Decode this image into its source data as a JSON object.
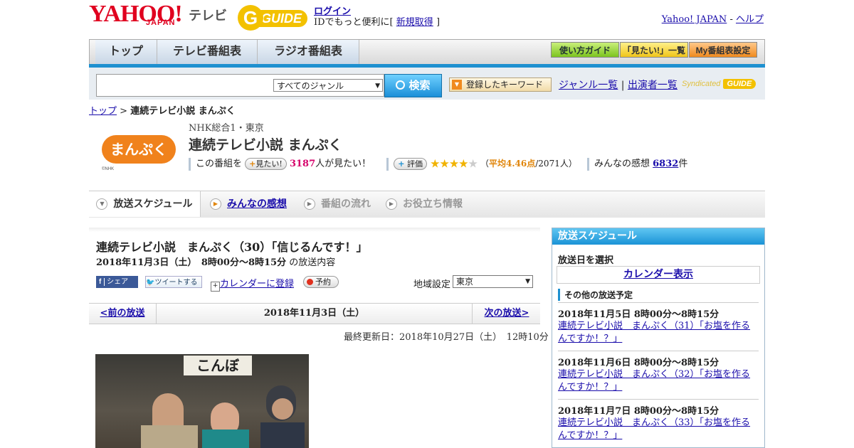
{
  "header": {
    "logo_yahoo": "YAHOO!",
    "logo_japan": "JAPAN",
    "logo_tv": "テレビ",
    "gguide_g": "G",
    "gguide_text": "GUIDE",
    "login": "ログイン",
    "login_prefix": "IDでもっと便利に[",
    "register": "新規取得",
    "login_suffix": "]",
    "yahoo_japan_link": "Yahoo! JAPAN",
    "separator": " - ",
    "help_link": "ヘルプ"
  },
  "nav": {
    "tabs": [
      "トップ",
      "テレビ番組表",
      "ラジオ番組表"
    ],
    "buttons": [
      "使い方ガイド",
      "「見たい!」一覧",
      "My番組表設定"
    ]
  },
  "search": {
    "placeholder": "",
    "genre_value": "すべてのジャンル",
    "search_button": "検索",
    "keyword_button": "登録したキーワード",
    "genre_list": "ジャンル一覧",
    "divider": "|",
    "performers": "出演者一覧",
    "syndicated": "Syndicated",
    "syndicated_guide": "GUIDE"
  },
  "breadcrumb": {
    "top": "トップ",
    "sep": " > ",
    "current": "連続テレビ小説 まんぷく"
  },
  "program": {
    "logo_text": "まんぷく",
    "logo_small": "©NHK",
    "channel": "NHK総合1・東京",
    "title": "連続テレビ小説 まんぷく",
    "want_prefix": "この番組を",
    "want_button": "見たい!",
    "want_count": "3187",
    "want_suffix": "人が見たい！",
    "rate_button": "評価",
    "stars_filled": "★★★★",
    "stars_empty": "★",
    "rating": 4.46,
    "avg_open": "（",
    "avg_label": "平均4.46点",
    "avg_people": "/2071人）",
    "impressions_label": "みんなの感想",
    "impressions_count": "6832",
    "impressions_suffix": "件"
  },
  "tabs": {
    "items": [
      "放送スケジュール",
      "みんなの感想",
      "番組の流れ",
      "お役立ち情報"
    ]
  },
  "episode": {
    "title": "連続テレビ小説　まんぷく（30）「信じるんです！」",
    "date_time": "2018年11月3日（土）　8時00分～8時15分",
    "date_suffix": "の放送内容",
    "share": "シェア",
    "tweet": "ツイートする",
    "calendar": "カレンダーに登録",
    "reserve": "予約",
    "region_label": "地域設定",
    "region_value": "東京",
    "prev": "<前の放送",
    "pager_date": "2018年11月3日（土）",
    "next": "次の放送>",
    "updated": "最終更新日：2018年10月27日（土）　12時10分",
    "photo_sign": "こんぼ"
  },
  "sidebar": {
    "title": "放送スケジュール",
    "select_label": "放送日を選択",
    "calendar_link": "カレンダー表示",
    "other_label": "その他の放送予定",
    "items": [
      {
        "date": "2018年11月5日  8時00分～8時15分",
        "title": "連続テレビ小説　まんぷく（31）「お塩を作るんですか！？」"
      },
      {
        "date": "2018年11月6日  8時00分～8時15分",
        "title": "連続テレビ小説　まんぷく（32）「お塩を作るんですか！？」"
      },
      {
        "date": "2018年11月7日  8時00分～8時15分",
        "title": "連続テレビ小説　まんぷく（33）「お塩を作るんですか！？」"
      }
    ]
  },
  "colors": {
    "yahoo_red": "#e0001f",
    "accent_blue": "#1e90d0",
    "gguide_yellow": "#f3c100",
    "want_count": "#d6006a",
    "rating_orange": "#e0850a"
  }
}
